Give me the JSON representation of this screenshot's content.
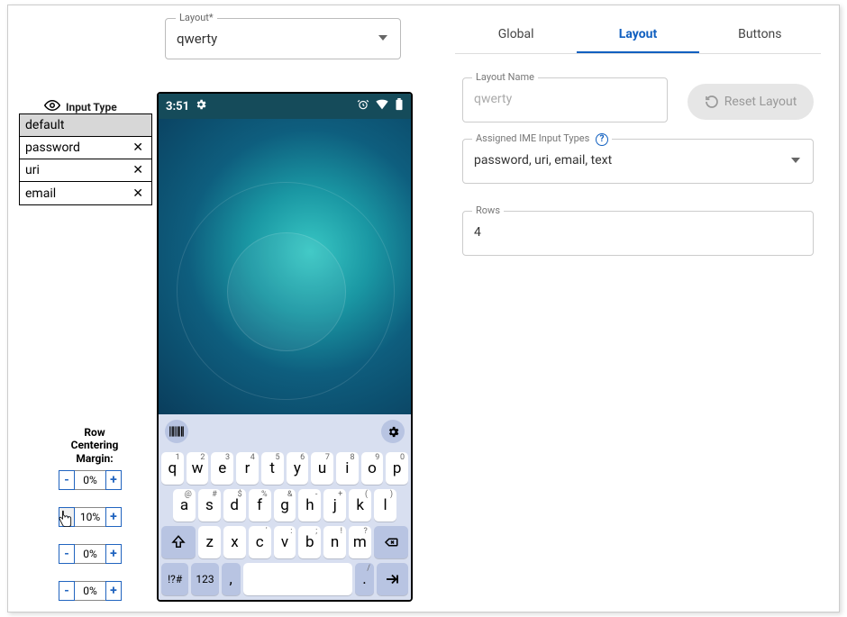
{
  "layoutDropdown": {
    "label": "Layout*",
    "value": "qwerty"
  },
  "inputType": {
    "header": "Input Type",
    "items": [
      {
        "label": "default",
        "selected": true,
        "close": ""
      },
      {
        "label": "password",
        "selected": false,
        "close": "✕"
      },
      {
        "label": "uri",
        "selected": false,
        "close": "✕"
      },
      {
        "label": "email",
        "selected": false,
        "close": "✕"
      }
    ]
  },
  "rowCentering": {
    "label1": "Row",
    "label2": "Centering",
    "label3": "Margin:",
    "rows": [
      {
        "value": "0%"
      },
      {
        "value": "10%"
      },
      {
        "value": "0%"
      },
      {
        "value": "0%"
      }
    ],
    "minus": "-",
    "plus": "+"
  },
  "phone": {
    "time": "3:51"
  },
  "keyboard": {
    "row1": [
      {
        "k": "q",
        "s": "1"
      },
      {
        "k": "w",
        "s": "2"
      },
      {
        "k": "e",
        "s": "3"
      },
      {
        "k": "r",
        "s": "4"
      },
      {
        "k": "t",
        "s": "5"
      },
      {
        "k": "y",
        "s": "6"
      },
      {
        "k": "u",
        "s": "7"
      },
      {
        "k": "i",
        "s": "8"
      },
      {
        "k": "o",
        "s": "9"
      },
      {
        "k": "p",
        "s": "0"
      }
    ],
    "row2": [
      {
        "k": "a",
        "s": "@"
      },
      {
        "k": "s",
        "s": "#"
      },
      {
        "k": "d",
        "s": "$"
      },
      {
        "k": "f",
        "s": "%"
      },
      {
        "k": "g",
        "s": "&"
      },
      {
        "k": "h",
        "s": "-"
      },
      {
        "k": "j",
        "s": "+"
      },
      {
        "k": "k",
        "s": "("
      },
      {
        "k": "l",
        "s": ")"
      }
    ],
    "row3": [
      {
        "k": "z",
        "s": ""
      },
      {
        "k": "x",
        "s": ""
      },
      {
        "k": "c",
        "s": "'"
      },
      {
        "k": "v",
        "s": ":"
      },
      {
        "k": "b",
        "s": ";"
      },
      {
        "k": "n",
        "s": "!"
      },
      {
        "k": "m",
        "s": "?"
      }
    ],
    "sym": "!?#",
    "num": "123",
    "comma": ",",
    "period": "."
  },
  "tabs": {
    "global": "Global",
    "layout": "Layout",
    "buttons": "Buttons"
  },
  "right": {
    "layoutNameLabel": "Layout Name",
    "layoutNameValue": "qwerty",
    "resetLabel": "Reset Layout",
    "imeLabel": "Assigned IME Input Types",
    "imeValue": "password, uri, email, text",
    "rowsLabel": "Rows",
    "rowsValue": "4",
    "help": "?"
  }
}
